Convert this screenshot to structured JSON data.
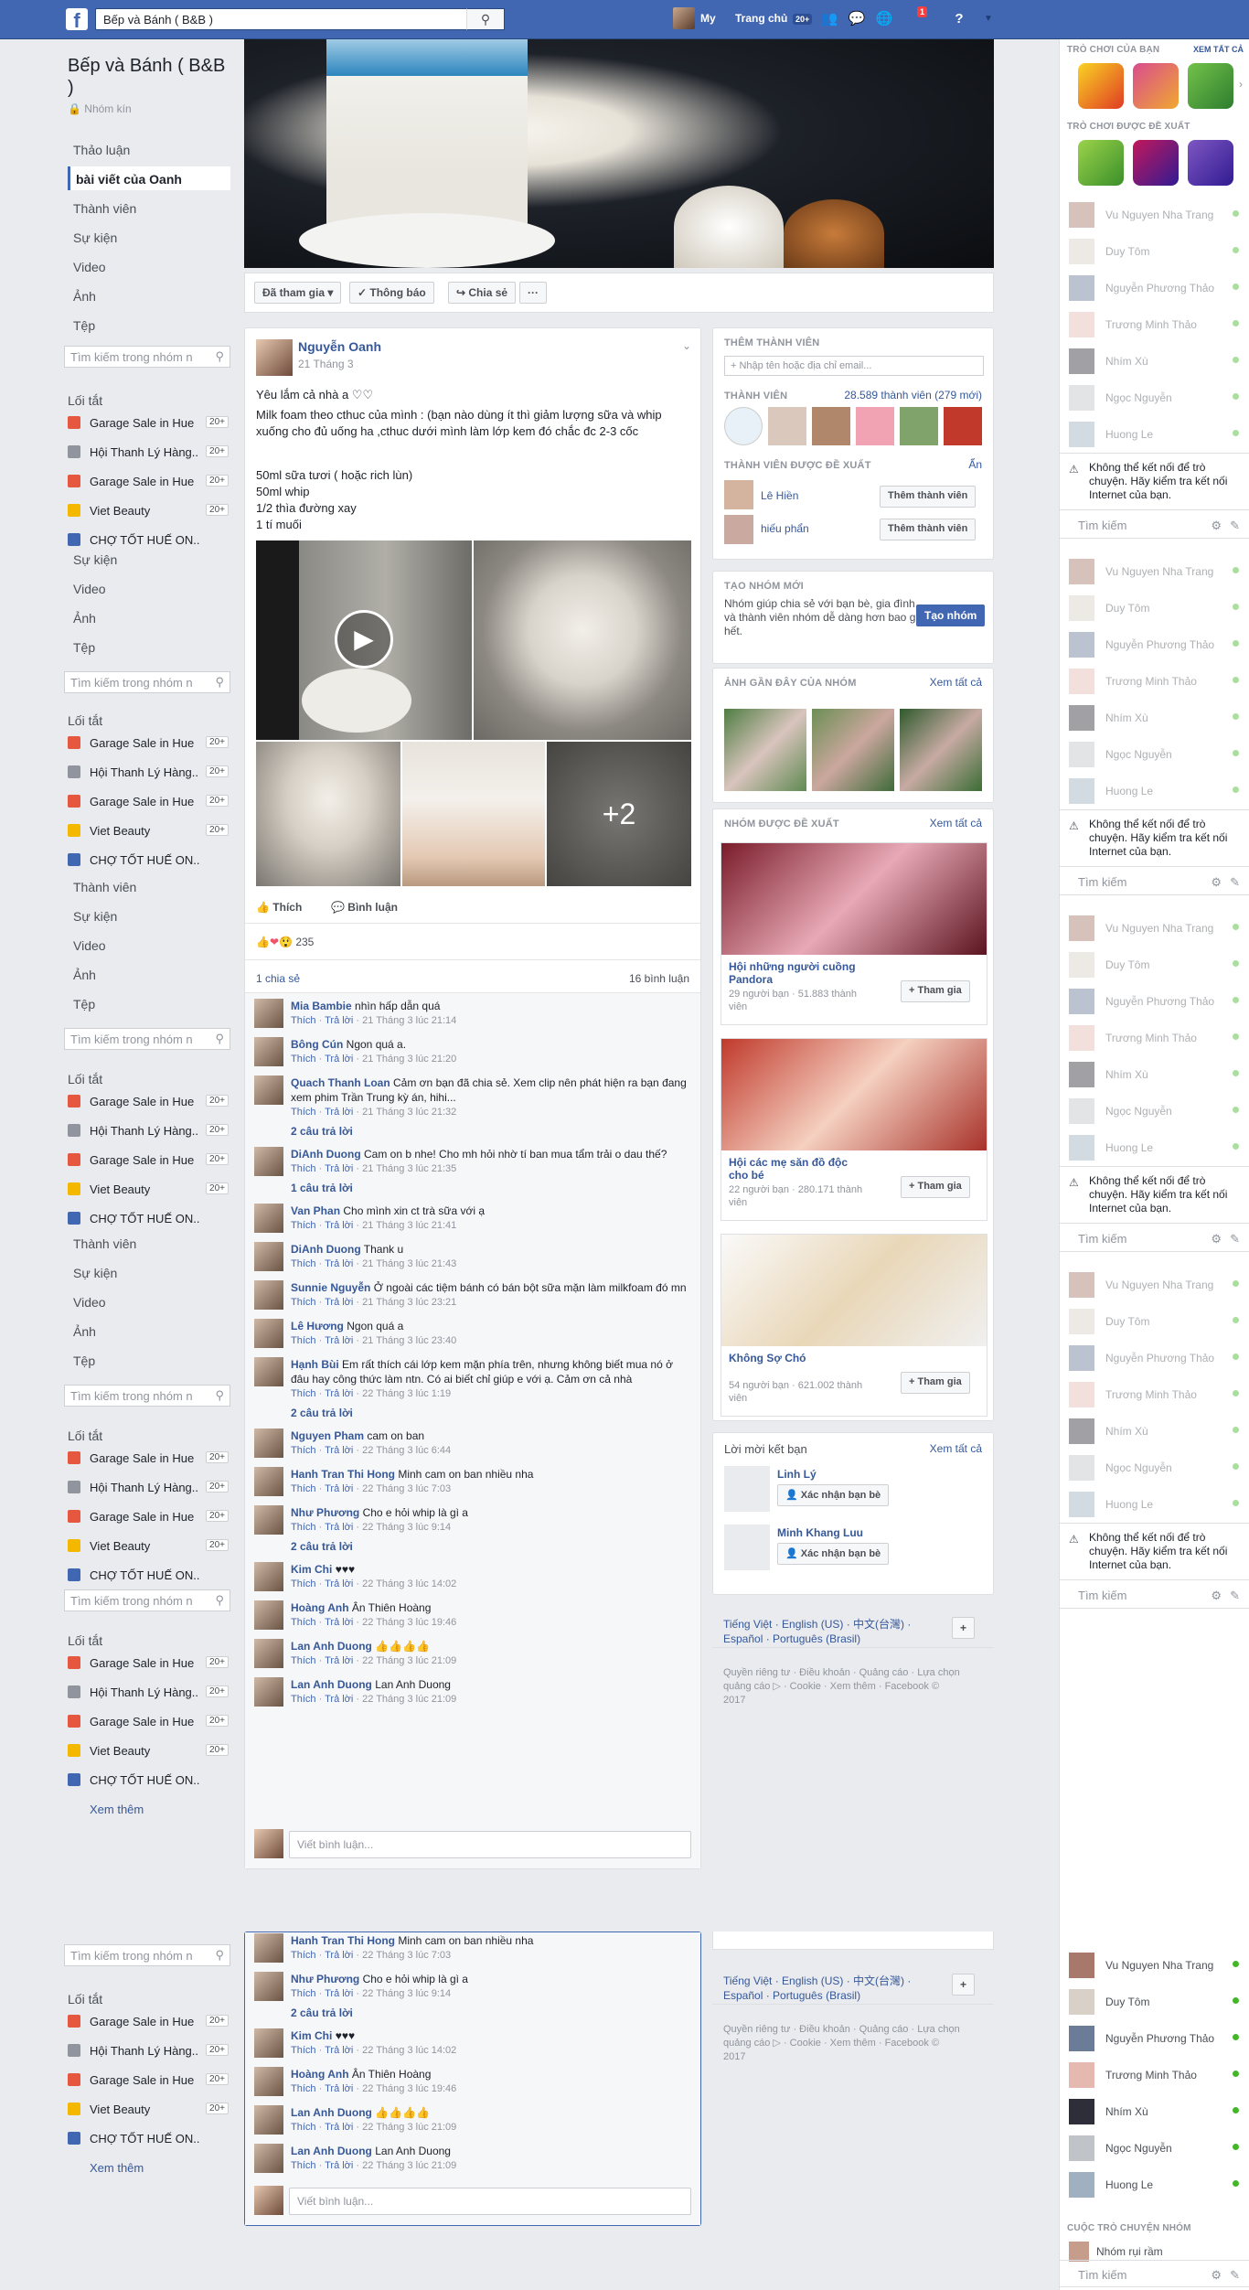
{
  "topbar": {
    "search_value": "Bếp và Bánh ( B&B )",
    "profile_label": "My",
    "home_label": "Trang chủ",
    "home_badge": "20+",
    "notif_badge": "1"
  },
  "group": {
    "title": "Bếp và Bánh ( B&B )",
    "closed": "Nhóm kín"
  },
  "nav": [
    "Thảo luận",
    "bài viết của Oanh",
    "Thành viên",
    "Sự kiện",
    "Video",
    "Ảnh",
    "Tệp"
  ],
  "nav_short": [
    "Sự kiện",
    "Video",
    "Ảnh",
    "Tệp"
  ],
  "nav_mid": [
    "Thành viên",
    "Sự kiện",
    "Video",
    "Ảnh",
    "Tệp"
  ],
  "side_search_placeholder": "Tìm kiếm trong nhóm n",
  "shortcuts_title": "Lối tắt",
  "shortcuts": [
    {
      "label": "Garage Sale in Hue",
      "count": "20+",
      "color": "#e6573f"
    },
    {
      "label": "Hội Thanh Lý Hàng...",
      "count": "20+",
      "color": "#90949c"
    },
    {
      "label": "Garage Sale in Hue",
      "count": "20+",
      "color": "#e6573f"
    },
    {
      "label": "Viet Beauty",
      "count": "20+",
      "color": "#f5b800"
    },
    {
      "label": "CHỢ TỐT HUẾ ON...",
      "count": "",
      "color": "#4267b2"
    }
  ],
  "see_more": "Xem thêm",
  "cover_actions": {
    "joined": "Đã tham gia",
    "notifications": "Thông báo",
    "share": "Chia sẻ",
    "more": "···"
  },
  "post": {
    "author": "Nguyễn Oanh",
    "date": "21 Tháng 3",
    "lines": [
      "Yêu lắm cả nhà a ♡♡",
      "Milk foam theo cthuc của mình : (bạn nào dùng ít thì giảm lượng sữa và whip xuống cho đủ uống ha ,cthuc dưới mình làm lớp kem đó chắc đc 2-3 cốc",
      "50ml sữa tươi ( hoặc rich lùn)",
      "50ml whip",
      "1/2 thìa đường xay",
      "1 tí muối"
    ],
    "more_photos": "+2",
    "like": "Thích",
    "comment": "Bình luận",
    "reactions": "235",
    "shares": "1 chia sẻ",
    "comments_count": "16 bình luận",
    "write_comment": "Viết bình luận..."
  },
  "comments": [
    {
      "name": "Mia Bambie",
      "text": "nhìn hấp dẫn quá",
      "meta": "21 Tháng 3 lúc 21:14"
    },
    {
      "name": "Bông Cún",
      "text": "Ngon quá a.",
      "meta": "21 Tháng 3 lúc 21:20"
    },
    {
      "name": "Quach Thanh Loan",
      "text": "Cảm ơn bạn đã chia sẻ. Xem clip nên phát hiện ra bạn đang xem phim Trần Trung kỳ án, hihi...",
      "meta": "21 Tháng 3 lúc 21:32",
      "replies": "2 câu trả lời"
    },
    {
      "name": "DiAnh Duong",
      "text": "Cam on b nhe! Cho mh hỏi nhờ tí ban mua tẩm trải o dau thế?",
      "meta": "21 Tháng 3 lúc 21:35",
      "replies": "1 câu trả lời"
    },
    {
      "name": "Van Phan",
      "text": "Cho mình xin ct trà sữa với ạ",
      "meta": "21 Tháng 3 lúc 21:41"
    },
    {
      "name": "DiAnh Duong",
      "text": "Thank u",
      "meta": "21 Tháng 3 lúc 21:43"
    },
    {
      "name": "Sunnie Nguyễn",
      "text": "Ở ngoài các tiệm bánh có bán bột sữa mặn làm milkfoam đó mn",
      "meta": "21 Tháng 3 lúc 23:21"
    },
    {
      "name": "Lê Hương",
      "text": "Ngon quá a",
      "meta": "21 Tháng 3 lúc 23:40"
    },
    {
      "name": "Hạnh Bùi",
      "text": "Em rất thích cái lớp kem mặn phía trên, nhưng không biết mua nó ở đâu hay công thức làm ntn. Có ai biết chỉ giúp e với ạ. Cảm ơn cả nhà",
      "meta": "22 Tháng 3 lúc 1:19",
      "replies": "2 câu trả lời"
    },
    {
      "name": "Nguyen Pham",
      "text": "cam on ban",
      "meta": "22 Tháng 3 lúc 6:44"
    },
    {
      "name": "Hanh Tran Thi Hong",
      "text": "Minh cam on ban nhiều nha",
      "meta": "22 Tháng 3 lúc 7:03"
    },
    {
      "name": "Như Phương",
      "text": "Cho e hỏi whip là gì a",
      "meta": "22 Tháng 3 lúc 9:14",
      "replies": "2 câu trả lời"
    },
    {
      "name": "Kim Chi",
      "text": "♥♥♥",
      "meta": "22 Tháng 3 lúc 14:02"
    },
    {
      "name": "Hoàng Anh",
      "text": "Ân Thiên Hoàng",
      "meta": "22 Tháng 3 lúc 19:46"
    },
    {
      "name": "Lan Anh Duong",
      "text": "👍👍👍👍",
      "meta": "22 Tháng 3 lúc 21:09"
    },
    {
      "name": "Lan Anh Duong",
      "text": "Lan Anh Duong",
      "meta": "22 Tháng 3 lúc 21:09"
    }
  ],
  "comment_actions": {
    "like": "Thích",
    "reply": "Trả lời"
  },
  "right": {
    "add_member_title": "THÊM THÀNH VIÊN",
    "add_member_placeholder": "+ Nhập tên hoặc địa chỉ email...",
    "members_title": "THÀNH VIÊN",
    "members_count": "28.589 thành viên (279 mới)",
    "suggested_title": "THÀNH VIÊN ĐƯỢC ĐỀ XUẤT",
    "hide": "Ẩn",
    "suggested": [
      {
        "name": "Lê Hiền",
        "btn": "Thêm thành viên"
      },
      {
        "name": "hiếu phẩn",
        "btn": "Thêm thành viên"
      }
    ],
    "new_group_title": "TẠO NHÓM MỚI",
    "new_group_text": "Nhóm giúp chia sẻ với bạn bè, gia đình và thành viên nhóm dễ dàng hơn bao giờ hết.",
    "new_group_btn": "Tạo nhóm",
    "recent_photos_title": "ẢNH GẦN ĐÂY CỦA NHÓM",
    "see_all": "Xem tất cả",
    "suggested_groups_title": "NHÓM ĐƯỢC ĐỀ XUẤT",
    "groups": [
      {
        "name": "Hội những người cuồng Pandora",
        "meta": "29 người bạn · 51.883 thành viên",
        "btn": "+ Tham gia"
      },
      {
        "name": "Hội các mẹ săn đồ độc cho bé",
        "meta": "22 người bạn · 280.171 thành viên",
        "btn": "+ Tham gia"
      },
      {
        "name": "Không Sợ Chó",
        "meta": "54 người bạn · 621.002 thành viên",
        "btn": "+ Tham gia"
      }
    ],
    "friend_requests_title": "Lời mời kết bạn",
    "requests": [
      {
        "name": "Linh Lý",
        "btn": "Xác nhận bạn bè"
      },
      {
        "name": "Minh Khang Luu",
        "btn": "Xác nhận bạn bè"
      }
    ],
    "languages": "Tiếng Việt · English (US) · 中文(台灣) · Español · Português (Brasil)",
    "footer": "Quyền riêng tư · Điều khoản · Quảng cáo · Lựa chọn quảng cáo ▷ · Cookie · Xem thêm · Facebook © 2017"
  },
  "chat": {
    "games_title": "TRÒ CHƠI CỦA BẠN",
    "see_all": "XEM TẤT CẢ",
    "games_suggested": "TRÒ CHƠI ĐƯỢC ĐỀ XUẤT",
    "contacts": [
      "Vu Nguyen Nha Trang",
      "Duy Tôm",
      "Nguyễn Phương Thảo",
      "Trương Minh Thảo",
      "Nhím Xù",
      "Ngọc Nguyễn",
      "Huong Le"
    ],
    "warning": "Không thể kết nối để trò chuyện. Hãy kiểm tra kết nối Internet của bạn.",
    "search": "Tìm kiếm",
    "group_chats": "CUỘC TRÒ CHUYỆN NHÓM",
    "group_chat_item": "Nhóm rụi rầm"
  }
}
